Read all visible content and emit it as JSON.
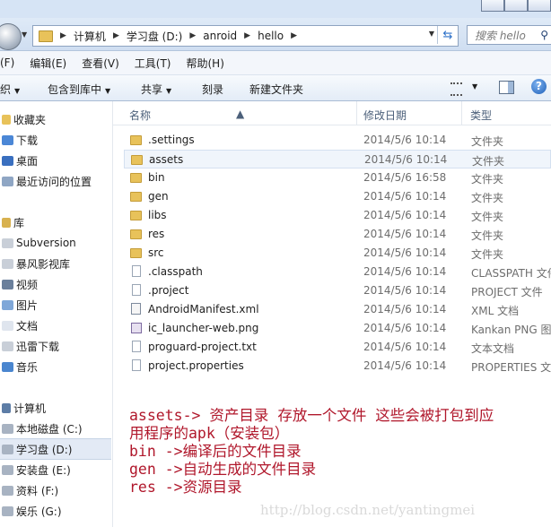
{
  "address": {
    "crumbs": [
      "计算机",
      "学习盘 (D:)",
      "anroid",
      "hello"
    ],
    "search_placeholder": "搜索 hello"
  },
  "menu": [
    "(F)",
    "编辑(E)",
    "查看(V)",
    "工具(T)",
    "帮助(H)"
  ],
  "toolbar": {
    "organize": "织",
    "include_in_library": "包含到库中",
    "share": "共享",
    "burn": "刻录",
    "new_folder": "新建文件夹"
  },
  "sidebar": {
    "favorites_header": "收藏夹",
    "favorites": [
      "下载",
      "桌面",
      "最近访问的位置"
    ],
    "libraries_header": "库",
    "libraries": [
      "Subversion",
      "暴风影视库",
      "视频",
      "图片",
      "文档",
      "迅雷下载",
      "音乐"
    ],
    "computer_header": "计算机",
    "drives": [
      "本地磁盘 (C:)",
      "学习盘 (D:)",
      "安装盘 (E:)",
      "资料 (F:)",
      "娱乐 (G:)"
    ]
  },
  "columns": {
    "name": "名称",
    "modified": "修改日期",
    "type": "类型"
  },
  "files": [
    {
      "name": ".settings",
      "date": "2014/5/6 10:14",
      "type": "文件夹",
      "icon": "folder"
    },
    {
      "name": "assets",
      "date": "2014/5/6 10:14",
      "type": "文件夹",
      "icon": "folder"
    },
    {
      "name": "bin",
      "date": "2014/5/6 16:58",
      "type": "文件夹",
      "icon": "folder"
    },
    {
      "name": "gen",
      "date": "2014/5/6 10:14",
      "type": "文件夹",
      "icon": "folder"
    },
    {
      "name": "libs",
      "date": "2014/5/6 10:14",
      "type": "文件夹",
      "icon": "folder"
    },
    {
      "name": "res",
      "date": "2014/5/6 10:14",
      "type": "文件夹",
      "icon": "folder"
    },
    {
      "name": "src",
      "date": "2014/5/6 10:14",
      "type": "文件夹",
      "icon": "folder"
    },
    {
      "name": ".classpath",
      "date": "2014/5/6 10:14",
      "type": "CLASSPATH 文件",
      "icon": "doc"
    },
    {
      "name": ".project",
      "date": "2014/5/6 10:14",
      "type": "PROJECT 文件",
      "icon": "doc"
    },
    {
      "name": "AndroidManifest.xml",
      "date": "2014/5/6 10:14",
      "type": "XML 文档",
      "icon": "xml"
    },
    {
      "name": "ic_launcher-web.png",
      "date": "2014/5/6 10:14",
      "type": "Kankan PNG 图",
      "icon": "png"
    },
    {
      "name": "proguard-project.txt",
      "date": "2014/5/6 10:14",
      "type": "文本文档",
      "icon": "doc"
    },
    {
      "name": "project.properties",
      "date": "2014/5/6 10:14",
      "type": "PROPERTIES 文",
      "icon": "doc"
    }
  ],
  "annotations": [
    "assets-> 资产目录 存放一个文件 这些会被打包到应",
    "用程序的apk（安装包）",
    "bin ->编译后的文件目录",
    "gen ->自动生成的文件目录",
    "res ->资源目录"
  ],
  "watermark": "http://blog.csdn.net/yantingmei",
  "colors": {
    "annotation": "#b0172b",
    "folder": "#e8c25a",
    "selection": "#e3eaf5"
  }
}
